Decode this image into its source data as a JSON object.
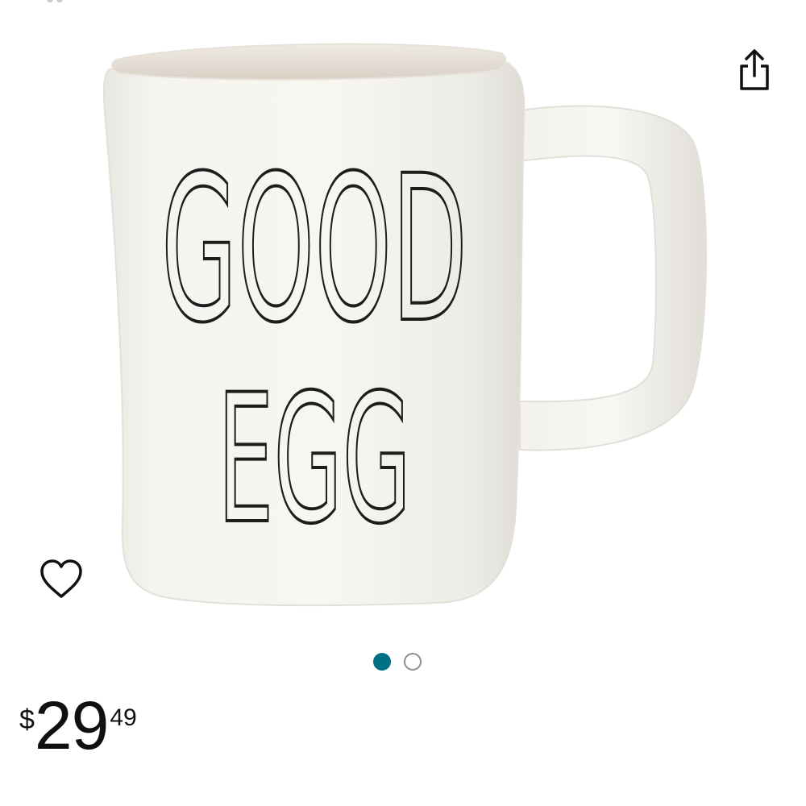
{
  "header": {
    "share_icon": "share-icon"
  },
  "gallery": {
    "image_alt": "product-photo",
    "mug_text": {
      "line1": "GOOD",
      "line2": "EGG"
    },
    "wishlist_icon": "heart-outline-icon",
    "pager": {
      "total": 2,
      "active_index": 0,
      "active_color": "#007185",
      "inactive_color": "#8a8f94"
    }
  },
  "price": {
    "symbol": "$",
    "whole": "29",
    "fraction": "49"
  }
}
